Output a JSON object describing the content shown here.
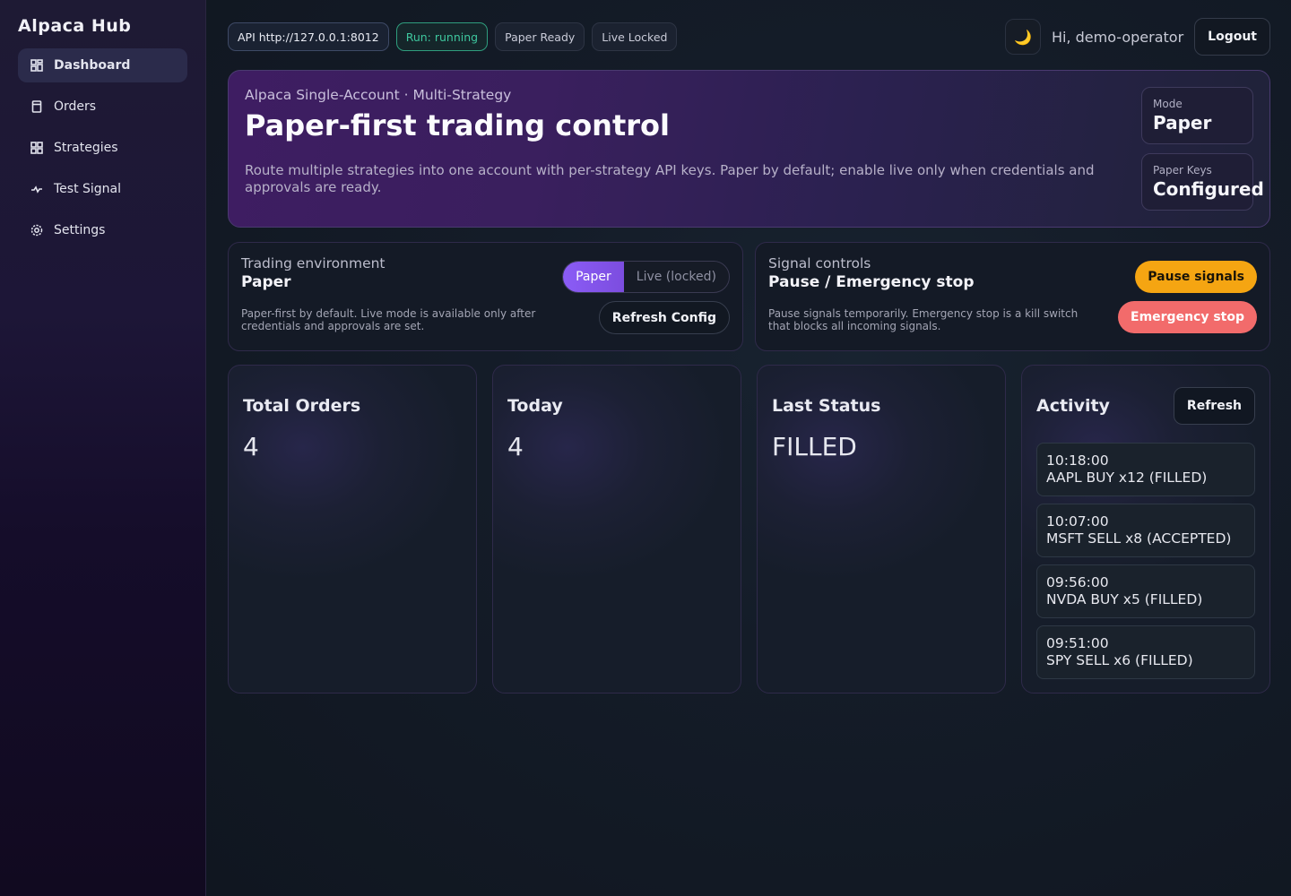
{
  "sidebar": {
    "brand": "Alpaca Hub",
    "items": [
      {
        "label": "Dashboard",
        "icon": "dashboard-icon"
      },
      {
        "label": "Orders",
        "icon": "orders-icon"
      },
      {
        "label": "Strategies",
        "icon": "grid-icon"
      },
      {
        "label": "Test Signal",
        "icon": "signal-icon"
      },
      {
        "label": "Settings",
        "icon": "gear-icon"
      }
    ]
  },
  "topbar": {
    "chips": {
      "api": "API http://127.0.0.1:8012",
      "run": "Run: running",
      "paper": "Paper Ready",
      "live": "Live Locked"
    },
    "theme_icon": "🌙",
    "greeting": "Hi, demo-operator",
    "logout_label": "Logout"
  },
  "hero": {
    "subtitle": "Alpaca Single-Account · Multi-Strategy",
    "title": "Paper-first trading control",
    "description": "Route multiple strategies into one account with per-strategy API keys. Paper by default; enable live only when credentials and approvals are ready.",
    "mode_label": "Mode",
    "mode_value": "Paper",
    "keys_label": "Paper Keys",
    "keys_value": "Configured"
  },
  "environment": {
    "label": "Trading environment",
    "title": "Paper",
    "description": "Paper-first by default. Live mode is available only after credentials and approvals are set.",
    "option_paper": "Paper",
    "option_live": "Live (locked)",
    "refresh_label": "Refresh Config"
  },
  "signals": {
    "label": "Signal controls",
    "title": "Pause / Emergency stop",
    "description": "Pause signals temporarily. Emergency stop is a kill switch that blocks all incoming signals.",
    "pause_label": "Pause signals",
    "estop_label": "Emergency stop"
  },
  "stats": {
    "total_orders": {
      "label": "Total Orders",
      "value": "4"
    },
    "today": {
      "label": "Today",
      "value": "4"
    },
    "last_status": {
      "label": "Last Status",
      "value": "FILLED"
    }
  },
  "activity": {
    "title": "Activity",
    "refresh_label": "Refresh",
    "items": [
      {
        "time": "10:18:00",
        "text": "AAPL BUY x12 (FILLED)"
      },
      {
        "time": "10:07:00",
        "text": "MSFT SELL x8 (ACCEPTED)"
      },
      {
        "time": "09:56:00",
        "text": "NVDA BUY x5 (FILLED)"
      },
      {
        "time": "09:51:00",
        "text": "SPY SELL x6 (FILLED)"
      }
    ]
  }
}
